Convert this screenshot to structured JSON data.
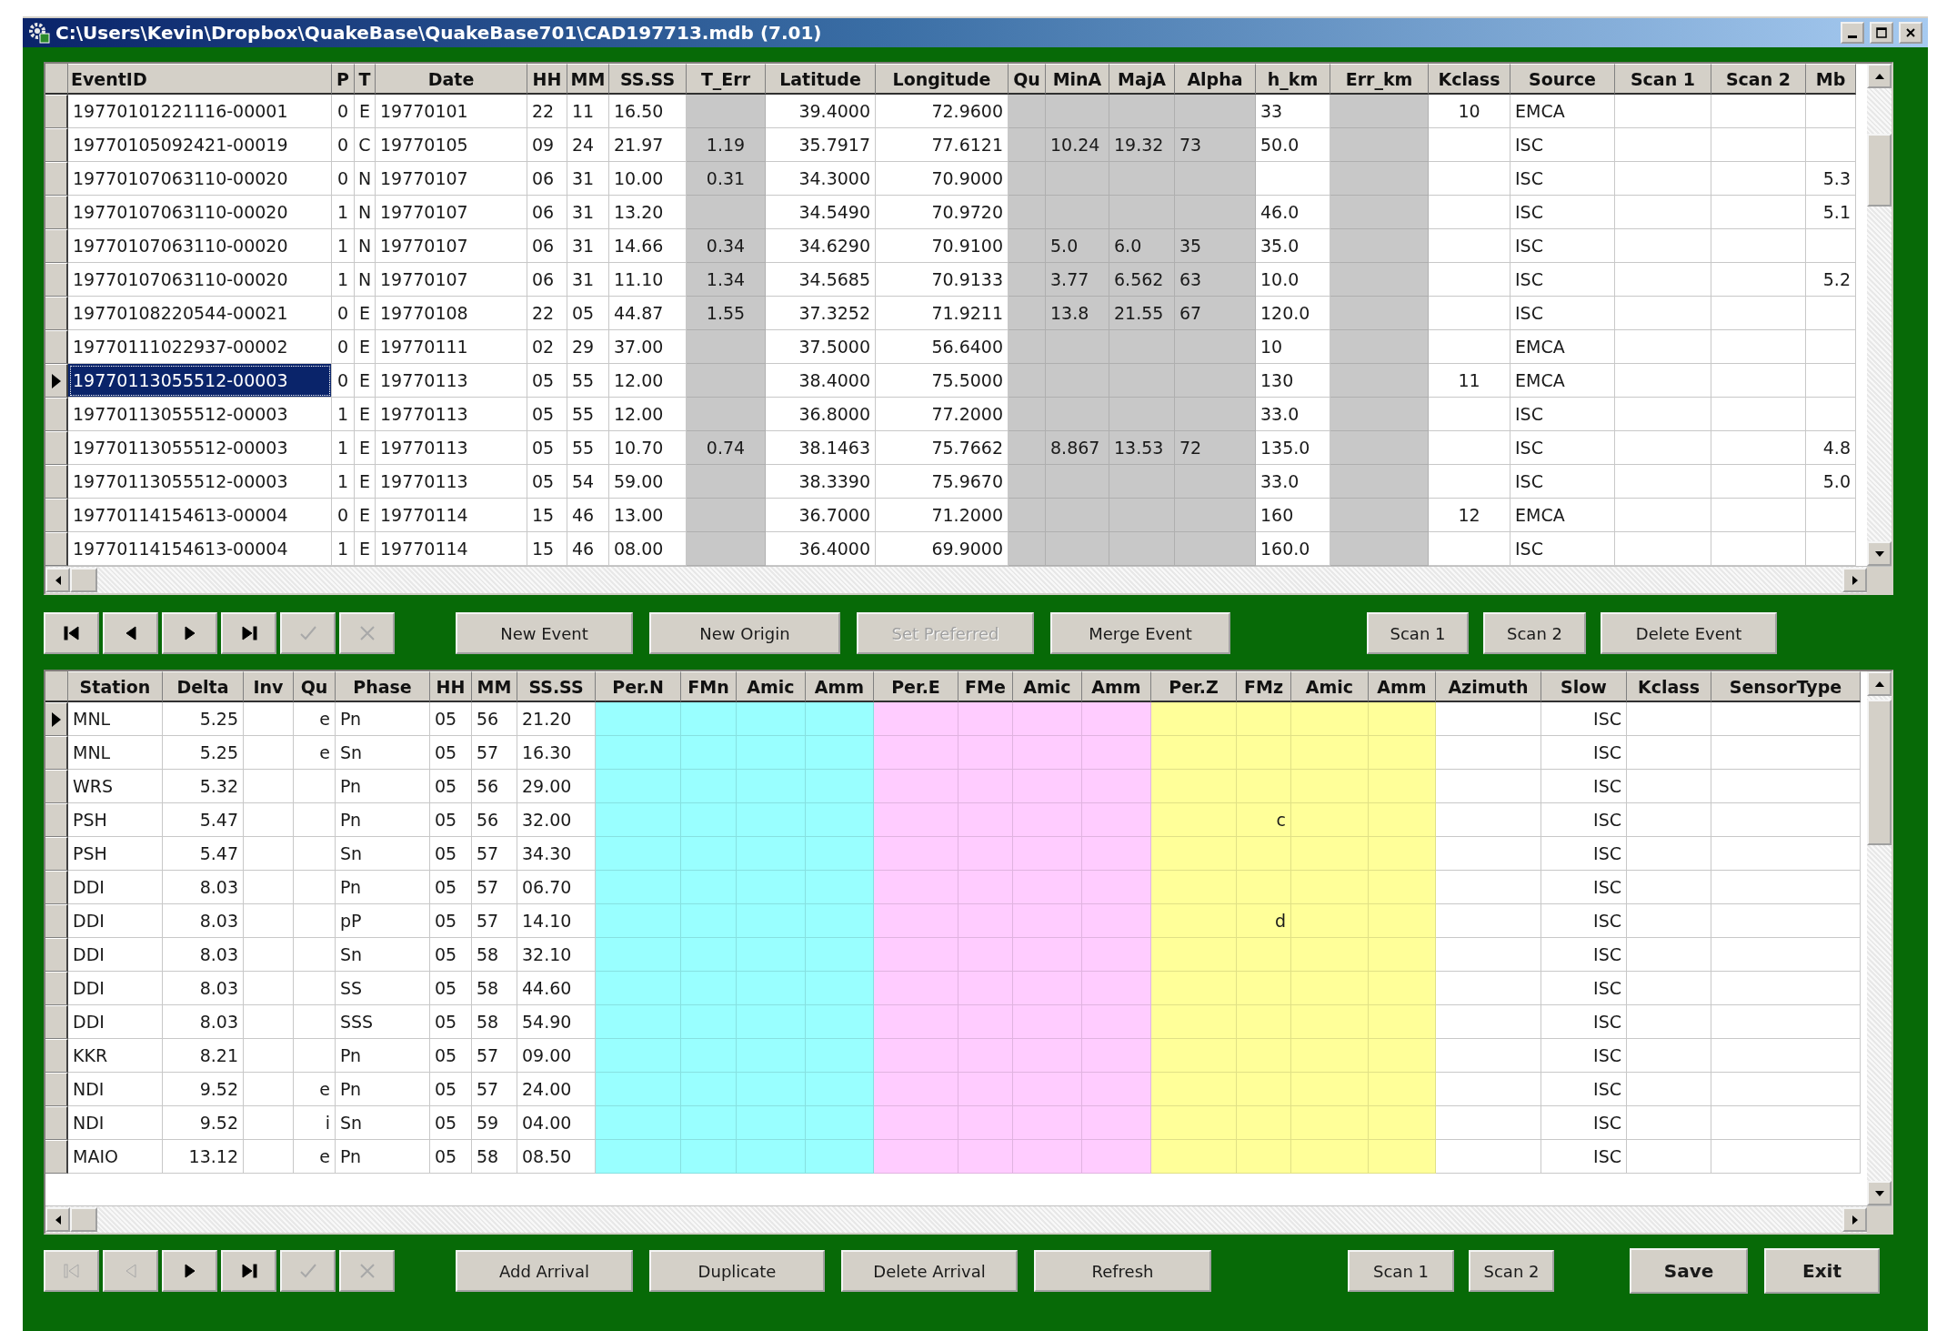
{
  "window": {
    "title": "C:\\Users\\Kevin\\Dropbox\\QuakeBase\\QuakeBase701\\CAD197713.mdb (7.01)"
  },
  "event_grid": {
    "columns": [
      {
        "label": "EventID",
        "shaded": false
      },
      {
        "label": "P",
        "shaded": false
      },
      {
        "label": "T",
        "shaded": false
      },
      {
        "label": "Date",
        "shaded": false
      },
      {
        "label": "HH",
        "shaded": false
      },
      {
        "label": "MM",
        "shaded": false
      },
      {
        "label": "SS.SS",
        "shaded": false
      },
      {
        "label": "T_Err",
        "shaded": true
      },
      {
        "label": "Latitude",
        "shaded": false
      },
      {
        "label": "Longitude",
        "shaded": false
      },
      {
        "label": "Qu",
        "shaded": true
      },
      {
        "label": "MinA",
        "shaded": true
      },
      {
        "label": "MajA",
        "shaded": true
      },
      {
        "label": "Alpha",
        "shaded": true
      },
      {
        "label": "h_km",
        "shaded": false
      },
      {
        "label": "Err_km",
        "shaded": true
      },
      {
        "label": "Kclass",
        "shaded": false
      },
      {
        "label": "Source",
        "shaded": false
      },
      {
        "label": "Scan 1",
        "shaded": false
      },
      {
        "label": "Scan 2",
        "shaded": false
      },
      {
        "label": "Mb",
        "shaded": false
      }
    ],
    "rows": [
      {
        "selected": false,
        "cells": [
          "19770101221116-00001",
          "0",
          "E",
          "19770101",
          "22",
          "11",
          "16.50",
          null,
          "39.4000",
          "72.9600",
          null,
          null,
          null,
          null,
          "33",
          null,
          "10",
          "EMCA",
          null,
          null,
          null
        ]
      },
      {
        "selected": false,
        "cells": [
          "19770105092421-00019",
          "0",
          "C",
          "19770105",
          "09",
          "24",
          "21.97",
          "1.19",
          "35.7917",
          "77.6121",
          null,
          "10.24",
          "19.32",
          "73",
          "50.0",
          null,
          null,
          "ISC",
          null,
          null,
          null
        ]
      },
      {
        "selected": false,
        "cells": [
          "19770107063110-00020",
          "0",
          "N",
          "19770107",
          "06",
          "31",
          "10.00",
          "0.31",
          "34.3000",
          "70.9000",
          null,
          null,
          null,
          null,
          null,
          null,
          null,
          "ISC",
          null,
          null,
          "5.3"
        ]
      },
      {
        "selected": false,
        "cells": [
          "19770107063110-00020",
          "1",
          "N",
          "19770107",
          "06",
          "31",
          "13.20",
          null,
          "34.5490",
          "70.9720",
          null,
          null,
          null,
          null,
          "46.0",
          null,
          null,
          "ISC",
          null,
          null,
          "5.1"
        ]
      },
      {
        "selected": false,
        "cells": [
          "19770107063110-00020",
          "1",
          "N",
          "19770107",
          "06",
          "31",
          "14.66",
          "0.34",
          "34.6290",
          "70.9100",
          null,
          "5.0",
          "6.0",
          "35",
          "35.0",
          null,
          null,
          "ISC",
          null,
          null,
          null
        ]
      },
      {
        "selected": false,
        "cells": [
          "19770107063110-00020",
          "1",
          "N",
          "19770107",
          "06",
          "31",
          "11.10",
          "1.34",
          "34.5685",
          "70.9133",
          null,
          "3.77",
          "6.562",
          "63",
          "10.0",
          null,
          null,
          "ISC",
          null,
          null,
          "5.2"
        ]
      },
      {
        "selected": false,
        "cells": [
          "19770108220544-00021",
          "0",
          "E",
          "19770108",
          "22",
          "05",
          "44.87",
          "1.55",
          "37.3252",
          "71.9211",
          null,
          "13.8",
          "21.55",
          "67",
          "120.0",
          null,
          null,
          "ISC",
          null,
          null,
          null
        ]
      },
      {
        "selected": false,
        "cells": [
          "19770111022937-00002",
          "0",
          "E",
          "19770111",
          "02",
          "29",
          "37.00",
          null,
          "37.5000",
          "56.6400",
          null,
          null,
          null,
          null,
          "10",
          null,
          null,
          "EMCA",
          null,
          null,
          null
        ]
      },
      {
        "selected": true,
        "cells": [
          "19770113055512-00003",
          "0",
          "E",
          "19770113",
          "05",
          "55",
          "12.00",
          null,
          "38.4000",
          "75.5000",
          null,
          null,
          null,
          null,
          "130",
          null,
          "11",
          "EMCA",
          null,
          null,
          null
        ]
      },
      {
        "selected": false,
        "cells": [
          "19770113055512-00003",
          "1",
          "E",
          "19770113",
          "05",
          "55",
          "12.00",
          null,
          "36.8000",
          "77.2000",
          null,
          null,
          null,
          null,
          "33.0",
          null,
          null,
          "ISC",
          null,
          null,
          null
        ]
      },
      {
        "selected": false,
        "cells": [
          "19770113055512-00003",
          "1",
          "E",
          "19770113",
          "05",
          "55",
          "10.70",
          "0.74",
          "38.1463",
          "75.7662",
          null,
          "8.867",
          "13.53",
          "72",
          "135.0",
          null,
          null,
          "ISC",
          null,
          null,
          "4.8"
        ]
      },
      {
        "selected": false,
        "cells": [
          "19770113055512-00003",
          "1",
          "E",
          "19770113",
          "05",
          "54",
          "59.00",
          null,
          "38.3390",
          "75.9670",
          null,
          null,
          null,
          null,
          "33.0",
          null,
          null,
          "ISC",
          null,
          null,
          "5.0"
        ]
      },
      {
        "selected": false,
        "cells": [
          "19770114154613-00004",
          "0",
          "E",
          "19770114",
          "15",
          "46",
          "13.00",
          null,
          "36.7000",
          "71.2000",
          null,
          null,
          null,
          null,
          "160",
          null,
          "12",
          "EMCA",
          null,
          null,
          null
        ]
      },
      {
        "selected": false,
        "cells": [
          "19770114154613-00004",
          "1",
          "E",
          "19770114",
          "15",
          "46",
          "08.00",
          null,
          "36.4000",
          "69.9000",
          null,
          null,
          null,
          null,
          "160.0",
          null,
          null,
          "ISC",
          null,
          null,
          null
        ]
      }
    ]
  },
  "event_toolbar": {
    "navigation": [
      {
        "kind": "first",
        "disabled": false
      },
      {
        "kind": "previous",
        "disabled": false
      },
      {
        "kind": "next",
        "disabled": false
      },
      {
        "kind": "last",
        "disabled": false
      },
      {
        "kind": "confirm",
        "disabled": true
      },
      {
        "kind": "cancel",
        "disabled": true
      }
    ],
    "buttons": [
      {
        "label": "New Event",
        "disabled": false
      },
      {
        "label": "New Origin",
        "disabled": false
      },
      {
        "label": "Set Preferred",
        "disabled": true
      },
      {
        "label": "Merge Event",
        "disabled": false
      }
    ],
    "side_buttons": [
      {
        "label": "Scan 1",
        "disabled": false
      },
      {
        "label": "Scan 2",
        "disabled": false
      },
      {
        "label": "Delete Event",
        "disabled": false
      }
    ]
  },
  "arrival_grid": {
    "columns": [
      {
        "label": "Station"
      },
      {
        "label": "Delta"
      },
      {
        "label": "Inv"
      },
      {
        "label": "Qu"
      },
      {
        "label": "Phase"
      },
      {
        "label": "HH"
      },
      {
        "label": "MM"
      },
      {
        "label": "SS.SS"
      },
      {
        "label": "Per.N",
        "color": "#99ffff"
      },
      {
        "label": "FMn",
        "color": "#99ffff"
      },
      {
        "label": "Amic",
        "color": "#99ffff"
      },
      {
        "label": "Amm",
        "color": "#99ffff"
      },
      {
        "label": "Per.E",
        "color": "#ffccff"
      },
      {
        "label": "FMe",
        "color": "#ffccff"
      },
      {
        "label": "Amic",
        "color": "#ffccff"
      },
      {
        "label": "Amm",
        "color": "#ffccff"
      },
      {
        "label": "Per.Z",
        "color": "#ffff99"
      },
      {
        "label": "FMz",
        "color": "#ffff99"
      },
      {
        "label": "Amic",
        "color": "#ffff99"
      },
      {
        "label": "Amm",
        "color": "#ffff99"
      },
      {
        "label": "Azimuth"
      },
      {
        "label": "Slow"
      },
      {
        "label": "Kclass"
      },
      {
        "label": "SensorType"
      }
    ],
    "rows": [
      {
        "selected": true,
        "cells": [
          "MNL",
          "5.25",
          null,
          "e",
          "Pn",
          "05",
          "56",
          "21.20",
          null,
          null,
          null,
          null,
          null,
          null,
          null,
          null,
          null,
          null,
          null,
          null,
          null,
          "ISC",
          null,
          null
        ]
      },
      {
        "selected": false,
        "cells": [
          "MNL",
          "5.25",
          null,
          "e",
          "Sn",
          "05",
          "57",
          "16.30",
          null,
          null,
          null,
          null,
          null,
          null,
          null,
          null,
          null,
          null,
          null,
          null,
          null,
          "ISC",
          null,
          null
        ]
      },
      {
        "selected": false,
        "cells": [
          "WRS",
          "5.32",
          null,
          null,
          "Pn",
          "05",
          "56",
          "29.00",
          null,
          null,
          null,
          null,
          null,
          null,
          null,
          null,
          null,
          null,
          null,
          null,
          null,
          "ISC",
          null,
          null
        ]
      },
      {
        "selected": false,
        "cells": [
          "PSH",
          "5.47",
          null,
          null,
          "Pn",
          "05",
          "56",
          "32.00",
          null,
          null,
          null,
          null,
          null,
          null,
          null,
          null,
          null,
          "c",
          null,
          null,
          null,
          "ISC",
          null,
          null
        ]
      },
      {
        "selected": false,
        "cells": [
          "PSH",
          "5.47",
          null,
          null,
          "Sn",
          "05",
          "57",
          "34.30",
          null,
          null,
          null,
          null,
          null,
          null,
          null,
          null,
          null,
          null,
          null,
          null,
          null,
          "ISC",
          null,
          null
        ]
      },
      {
        "selected": false,
        "cells": [
          "DDI",
          "8.03",
          null,
          null,
          "Pn",
          "05",
          "57",
          "06.70",
          null,
          null,
          null,
          null,
          null,
          null,
          null,
          null,
          null,
          null,
          null,
          null,
          null,
          "ISC",
          null,
          null
        ]
      },
      {
        "selected": false,
        "cells": [
          "DDI",
          "8.03",
          null,
          null,
          "pP",
          "05",
          "57",
          "14.10",
          null,
          null,
          null,
          null,
          null,
          null,
          null,
          null,
          null,
          "d",
          null,
          null,
          null,
          "ISC",
          null,
          null
        ]
      },
      {
        "selected": false,
        "cells": [
          "DDI",
          "8.03",
          null,
          null,
          "Sn",
          "05",
          "58",
          "32.10",
          null,
          null,
          null,
          null,
          null,
          null,
          null,
          null,
          null,
          null,
          null,
          null,
          null,
          "ISC",
          null,
          null
        ]
      },
      {
        "selected": false,
        "cells": [
          "DDI",
          "8.03",
          null,
          null,
          "SS",
          "05",
          "58",
          "44.60",
          null,
          null,
          null,
          null,
          null,
          null,
          null,
          null,
          null,
          null,
          null,
          null,
          null,
          "ISC",
          null,
          null
        ]
      },
      {
        "selected": false,
        "cells": [
          "DDI",
          "8.03",
          null,
          null,
          "SSS",
          "05",
          "58",
          "54.90",
          null,
          null,
          null,
          null,
          null,
          null,
          null,
          null,
          null,
          null,
          null,
          null,
          null,
          "ISC",
          null,
          null
        ]
      },
      {
        "selected": false,
        "cells": [
          "KKR",
          "8.21",
          null,
          null,
          "Pn",
          "05",
          "57",
          "09.00",
          null,
          null,
          null,
          null,
          null,
          null,
          null,
          null,
          null,
          null,
          null,
          null,
          null,
          "ISC",
          null,
          null
        ]
      },
      {
        "selected": false,
        "cells": [
          "NDI",
          "9.52",
          null,
          "e",
          "Pn",
          "05",
          "57",
          "24.00",
          null,
          null,
          null,
          null,
          null,
          null,
          null,
          null,
          null,
          null,
          null,
          null,
          null,
          "ISC",
          null,
          null
        ]
      },
      {
        "selected": false,
        "cells": [
          "NDI",
          "9.52",
          null,
          "i",
          "Sn",
          "05",
          "59",
          "04.00",
          null,
          null,
          null,
          null,
          null,
          null,
          null,
          null,
          null,
          null,
          null,
          null,
          null,
          "ISC",
          null,
          null
        ]
      },
      {
        "selected": false,
        "cells": [
          "MAIO",
          "13.12",
          null,
          "e",
          "Pn",
          "05",
          "58",
          "08.50",
          null,
          null,
          null,
          null,
          null,
          null,
          null,
          null,
          null,
          null,
          null,
          null,
          null,
          "ISC",
          null,
          null
        ]
      }
    ]
  },
  "arrival_toolbar": {
    "navigation": [
      {
        "kind": "first",
        "disabled": true
      },
      {
        "kind": "previous",
        "disabled": true
      },
      {
        "kind": "next",
        "disabled": false
      },
      {
        "kind": "last",
        "disabled": false
      },
      {
        "kind": "confirm",
        "disabled": true
      },
      {
        "kind": "cancel",
        "disabled": true
      }
    ],
    "buttons": [
      {
        "label": "Add Arrival",
        "disabled": false
      },
      {
        "label": "Duplicate",
        "disabled": false
      },
      {
        "label": "Delete Arrival",
        "disabled": false
      },
      {
        "label": "Refresh",
        "disabled": false
      }
    ],
    "side_buttons": [
      {
        "label": "Scan 1",
        "disabled": false
      },
      {
        "label": "Scan 2",
        "disabled": false
      }
    ],
    "commit_buttons": [
      {
        "label": "Save",
        "disabled": false
      },
      {
        "label": "Exit",
        "disabled": false
      }
    ]
  }
}
